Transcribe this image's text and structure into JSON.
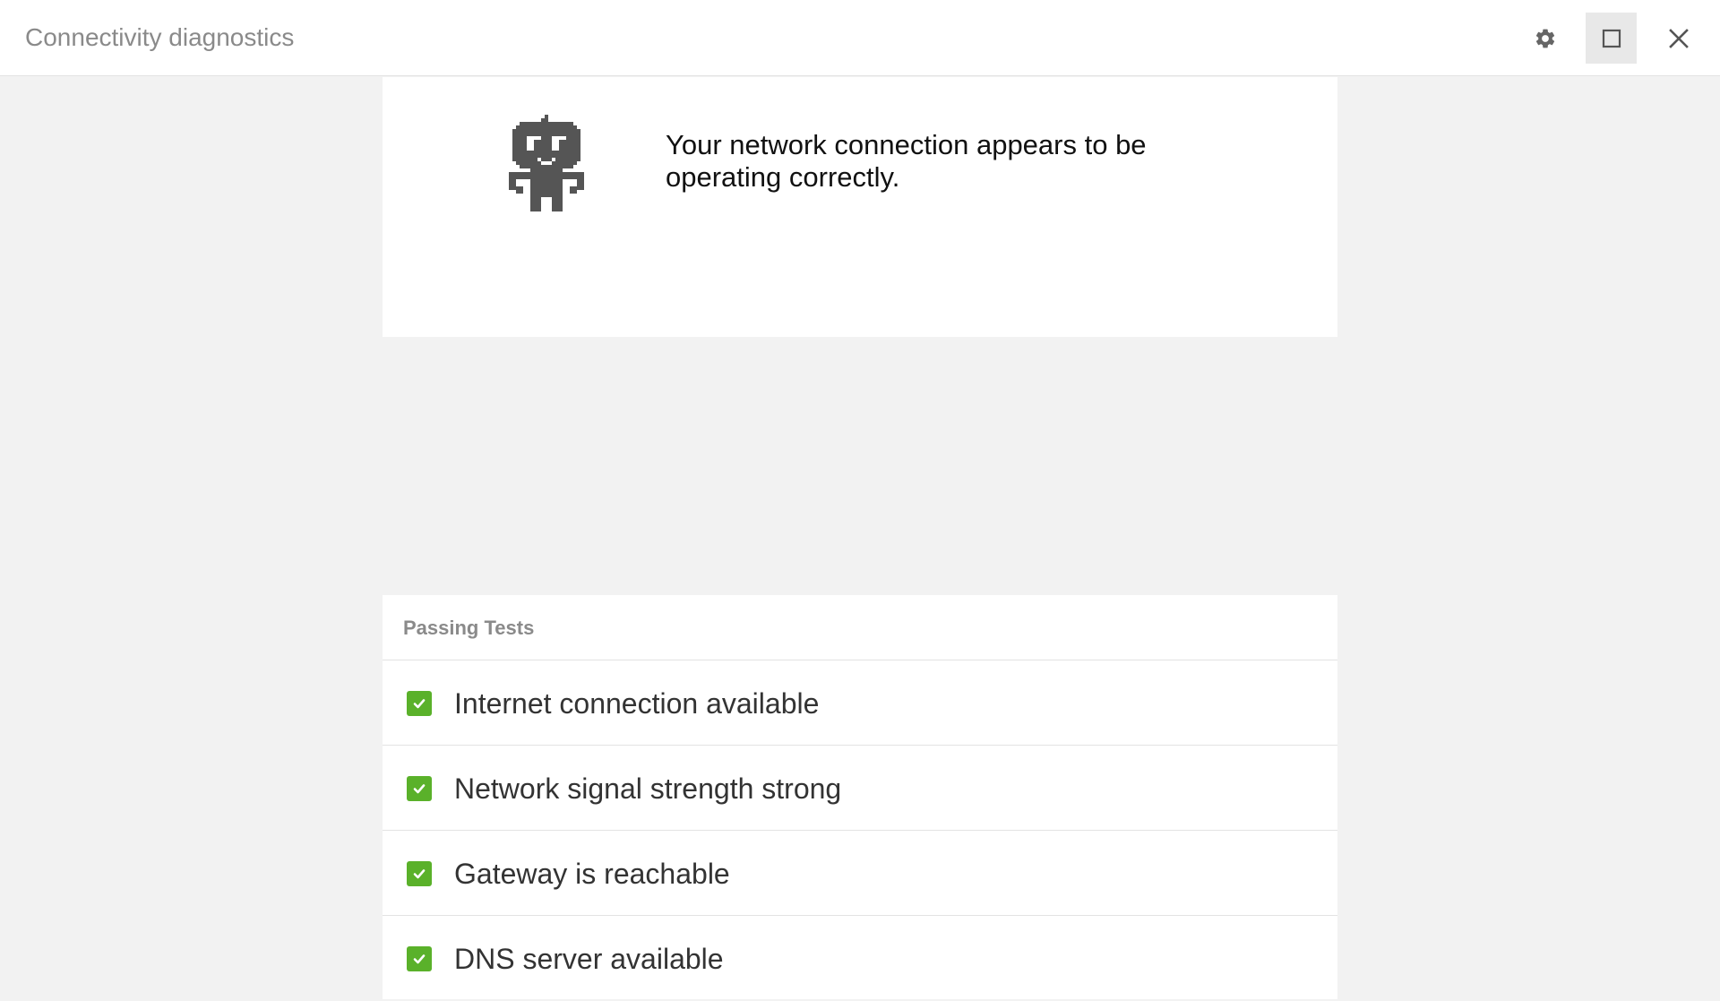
{
  "window": {
    "title": "Connectivity diagnostics",
    "icons": {
      "settings": "gear-icon",
      "maximize": "maximize-icon",
      "close": "close-icon"
    }
  },
  "status": {
    "icon": "robot-icon",
    "message": "Your network connection appears to be operating correctly."
  },
  "tests": {
    "header": "Passing Tests",
    "items": [
      {
        "label": "Internet connection available",
        "status": "pass"
      },
      {
        "label": "Network signal strength strong",
        "status": "pass"
      },
      {
        "label": "Gateway is reachable",
        "status": "pass"
      },
      {
        "label": "DNS server available",
        "status": "pass"
      }
    ]
  },
  "colors": {
    "pass": "#5ab12a",
    "background": "#f2f2f2",
    "icon": "#555555"
  }
}
